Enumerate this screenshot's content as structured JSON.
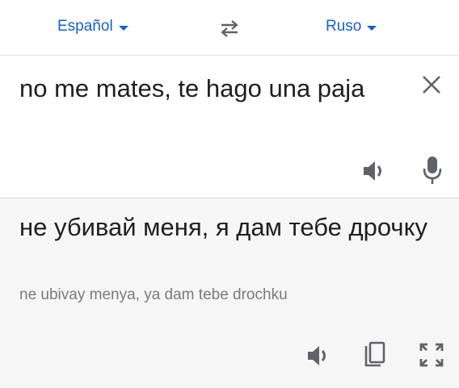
{
  "languages": {
    "source": "Español",
    "target": "Ruso"
  },
  "icons": {
    "swap": "swap-arrows-icon",
    "clear": "close-icon",
    "speaker": "speaker-icon",
    "mic": "microphone-icon",
    "copy": "copy-icon",
    "fullscreen": "fullscreen-icon"
  },
  "source": {
    "text": "no me mates, te hago una paja"
  },
  "result": {
    "translation": "не убивай меня, я дам тебе дрочку",
    "transliteration": "ne ubivay menya, ya dam tebe drochku"
  },
  "colors": {
    "accent": "#1a5fc4",
    "icon": "#5f6368",
    "result_bg": "#f6f6f6"
  }
}
